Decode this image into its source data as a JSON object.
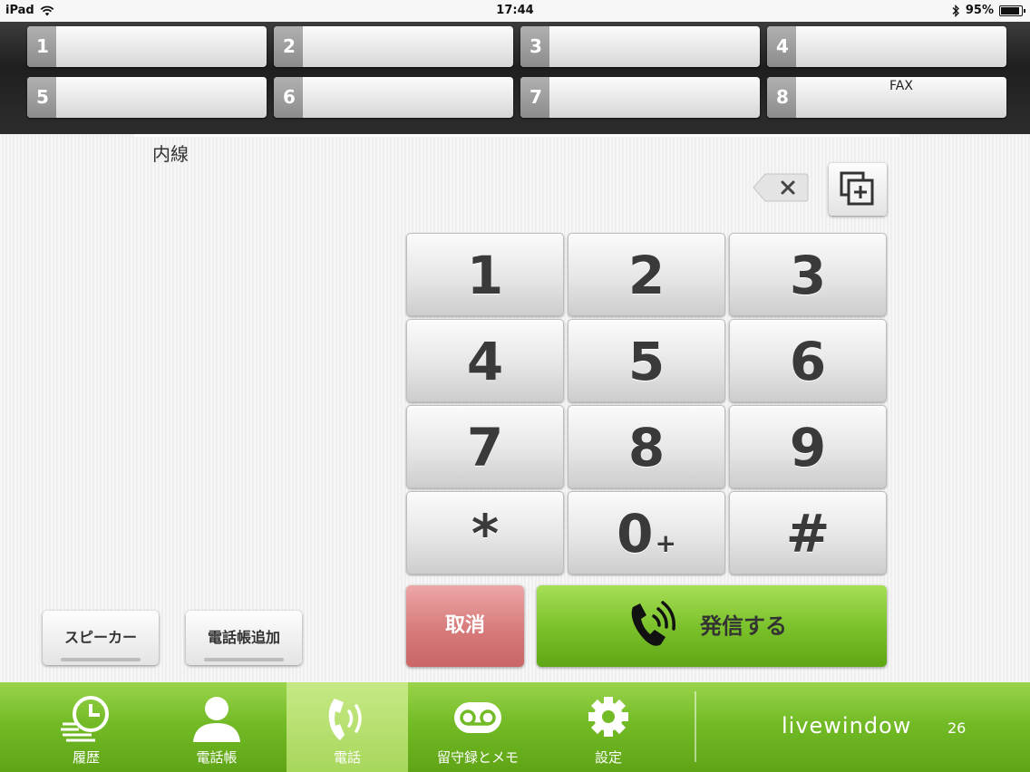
{
  "status": {
    "device": "iPad",
    "time": "17:44",
    "battery": "95%",
    "battery_level": 0.95
  },
  "lines": [
    {
      "num": "1",
      "label": ""
    },
    {
      "num": "2",
      "label": ""
    },
    {
      "num": "3",
      "label": ""
    },
    {
      "num": "4",
      "label": ""
    },
    {
      "num": "5",
      "label": ""
    },
    {
      "num": "6",
      "label": ""
    },
    {
      "num": "7",
      "label": ""
    },
    {
      "num": "8",
      "label": "FAX"
    }
  ],
  "dialer": {
    "line_label": "内線",
    "keys": [
      "1",
      "2",
      "3",
      "4",
      "5",
      "6",
      "7",
      "8",
      "9",
      "*",
      "0",
      "#"
    ],
    "zero_plus": "+",
    "cancel": "取消",
    "call": "発信する"
  },
  "actions": {
    "speaker": "スピーカー",
    "add_contact": "電話帳追加"
  },
  "tabs": [
    {
      "label": "履歴",
      "icon": "history-clock-icon"
    },
    {
      "label": "電話帳",
      "icon": "contact-person-icon"
    },
    {
      "label": "電話",
      "icon": "phone-icon"
    },
    {
      "label": "留守録とメモ",
      "icon": "voicemail-icon"
    },
    {
      "label": "設定",
      "icon": "gear-icon"
    }
  ],
  "brand": {
    "logo": "livewindow",
    "count": "26"
  },
  "colors": {
    "accent_green": "#73bb26",
    "cancel_red": "#d77a7a",
    "dark_strip": "#2b2b2b"
  }
}
